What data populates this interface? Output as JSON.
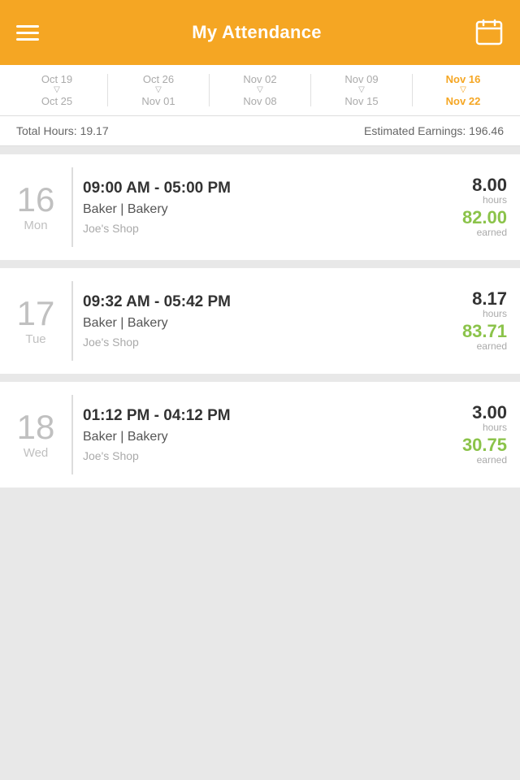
{
  "header": {
    "title": "My Attendance",
    "menu_icon": "menu-icon",
    "calendar_icon": "calendar-icon"
  },
  "date_nav": {
    "items": [
      {
        "top": "Oct 19",
        "bottom": "Oct 25",
        "active": false
      },
      {
        "top": "Oct 26",
        "bottom": "Nov 01",
        "active": false
      },
      {
        "top": "Nov 02",
        "bottom": "Nov 08",
        "active": false
      },
      {
        "top": "Nov 09",
        "bottom": "Nov 15",
        "active": false
      },
      {
        "top": "Nov 16",
        "bottom": "Nov 22",
        "active": true
      }
    ]
  },
  "summary": {
    "total_hours_label": "Total Hours:",
    "total_hours_value": "19.17",
    "estimated_earnings_label": "Estimated Earnings:",
    "estimated_earnings_value": "196.46"
  },
  "shifts": [
    {
      "date_number": "16",
      "date_day": "Mon",
      "time": "09:00 AM - 05:00 PM",
      "role": "Baker | Bakery",
      "shop": "Joe's Shop",
      "hours_value": "8.00",
      "hours_label": "hours",
      "earned_value": "82.00",
      "earned_label": "earned"
    },
    {
      "date_number": "17",
      "date_day": "Tue",
      "time": "09:32 AM - 05:42 PM",
      "role": "Baker | Bakery",
      "shop": "Joe's Shop",
      "hours_value": "8.17",
      "hours_label": "hours",
      "earned_value": "83.71",
      "earned_label": "earned"
    },
    {
      "date_number": "18",
      "date_day": "Wed",
      "time": "01:12 PM - 04:12 PM",
      "role": "Baker | Bakery",
      "shop": "Joe's Shop",
      "hours_value": "3.00",
      "hours_label": "hours",
      "earned_value": "30.75",
      "earned_label": "earned"
    }
  ]
}
